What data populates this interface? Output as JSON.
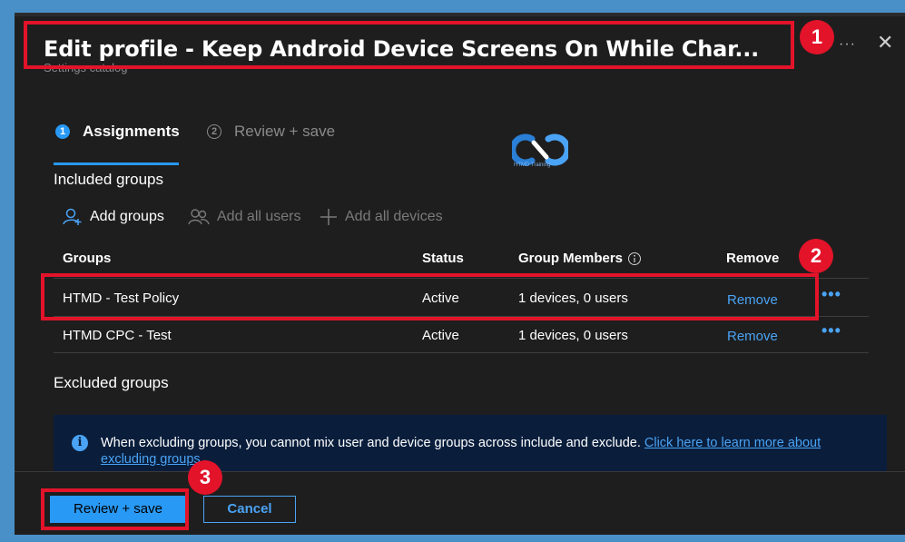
{
  "dialog": {
    "title": "Edit profile - Keep Android Device Screens On While Char...",
    "subtitle": "Settings catalog",
    "more_label": "···",
    "close_label": "✕"
  },
  "steps": [
    {
      "number": "1",
      "label": "Assignments",
      "active": true
    },
    {
      "number": "2",
      "label": "Review + save",
      "active": false
    }
  ],
  "logo": {
    "text": "HTMD Training"
  },
  "included": {
    "label": "Included groups",
    "actions": {
      "add_groups": "Add groups",
      "add_all_users": "Add all users",
      "add_all_devices": "Add all devices"
    }
  },
  "table": {
    "headers": {
      "groups": "Groups",
      "status": "Status",
      "members": "Group Members",
      "remove": "Remove"
    },
    "rows": [
      {
        "group": "HTMD - Test Policy",
        "status": "Active",
        "members": "1 devices, 0 users",
        "remove": "Remove",
        "more": "•••"
      },
      {
        "group": "HTMD CPC - Test",
        "status": "Active",
        "members": "1 devices, 0 users",
        "remove": "Remove",
        "more": "•••"
      }
    ]
  },
  "excluded": {
    "label": "Excluded groups"
  },
  "info": {
    "icon": "i",
    "text": "When excluding groups, you cannot mix user and device groups across include and exclude. ",
    "link": "Click here to learn more about excluding groups"
  },
  "footer": {
    "review_save": "Review + save",
    "cancel": "Cancel"
  },
  "annotations": [
    "1",
    "2",
    "3"
  ],
  "colors": {
    "accent": "#2899f5",
    "annotation": "#e3132a",
    "background": "#1e1e1e",
    "info_background": "#0a1e3c"
  }
}
